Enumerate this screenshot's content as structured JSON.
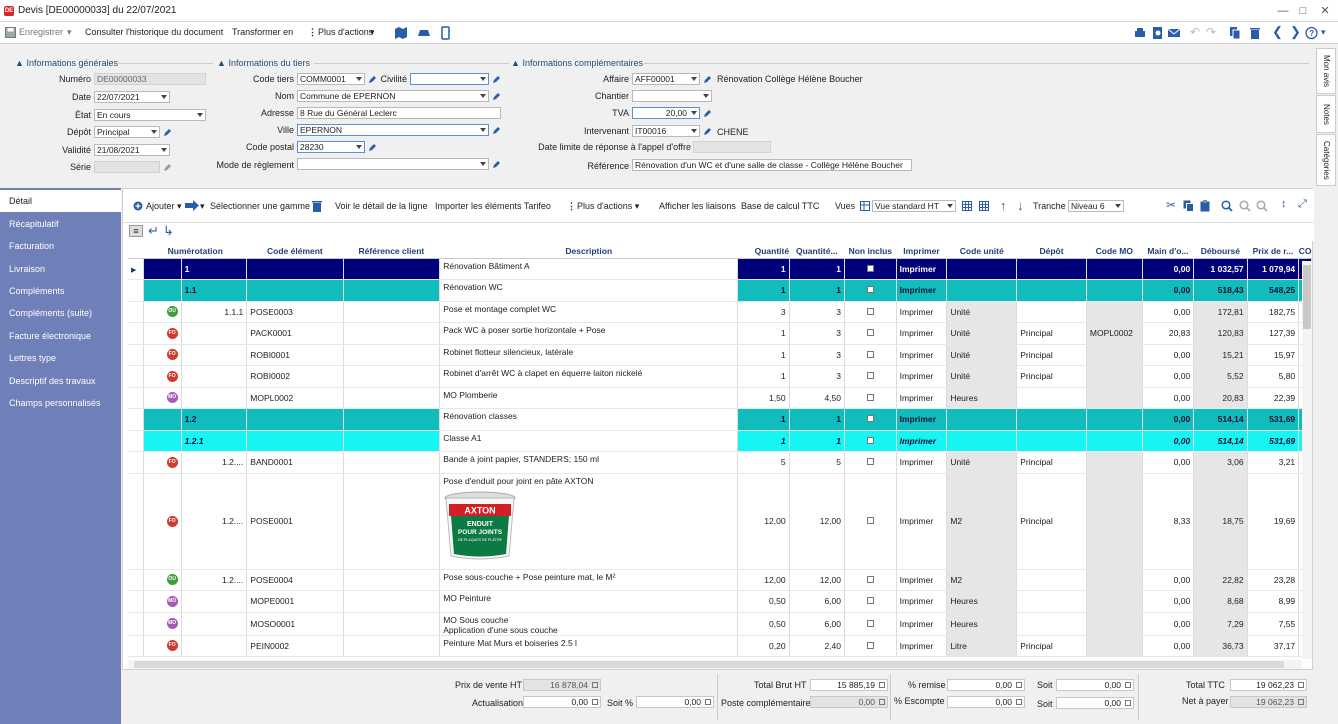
{
  "window": {
    "title": "Devis [DE00000033] du 22/07/2021",
    "app_icon": "DE"
  },
  "toolbar": {
    "save": "Enregistrer",
    "history": "Consulter l'historique du document",
    "transform": "Transformer en",
    "more_actions": "Plus d'actions"
  },
  "sections": {
    "general": "Informations générales",
    "tiers": "Informations du tiers",
    "complementary": "Informations complémentaires"
  },
  "general": {
    "numero_label": "Numéro",
    "numero": "DE00000033",
    "date_label": "Date",
    "date": "22/07/2021",
    "etat_label": "État",
    "etat": "En cours",
    "depot_label": "Dépôt",
    "depot": "Principal",
    "validite_label": "Validité",
    "validite": "21/08/2021",
    "serie_label": "Série",
    "serie": ""
  },
  "tiers": {
    "code_label": "Code tiers",
    "code": "COMM0001",
    "civilite_label": "Civilité",
    "civilite": "",
    "nom_label": "Nom",
    "nom": "Commune de EPERNON",
    "adresse_label": "Adresse",
    "adresse": "8 Rue du Général Leclerc",
    "ville_label": "Ville",
    "ville": "EPERNON",
    "cp_label": "Code postal",
    "cp": "28230",
    "reglement_label": "Mode de règlement",
    "reglement": ""
  },
  "complementary": {
    "affaire_label": "Affaire",
    "affaire": "AFF00001",
    "affaire_name": "Rénovation Collège Hélène Boucher",
    "chantier_label": "Chantier",
    "chantier": "",
    "tva_label": "TVA",
    "tva": "20,00",
    "intervenant_label": "Intervenant",
    "intervenant": "IT00016",
    "intervenant_name": "CHENE",
    "date_limite_label": "Date limite de réponse à l'appel d'offre",
    "date_limite": "",
    "reference_label": "Référence",
    "reference": "Rénovation d'un WC et d'une salle de classe - Collège Hélène Boucher"
  },
  "side_tabs": [
    "Mon avis",
    "Notes",
    "Catégories"
  ],
  "nav": [
    "Détail",
    "Récapitulatif",
    "Facturation",
    "Livraison",
    "Compléments",
    "Compléments (suite)",
    "Facture électronique",
    "Lettres type",
    "Descriptif des travaux",
    "Champs personnalisés"
  ],
  "grid_toolbar": {
    "add": "Ajouter",
    "select_range": "Sélectionner une gamme",
    "line_detail": "Voir le détail de la ligne",
    "import": "Importer les éléments Tarifeo",
    "more_actions": "Plus d'actions",
    "show_links": "Afficher les liaisons",
    "ttc_base": "Base de calcul TTC",
    "views_label": "Vues",
    "view": "Vue standard HT",
    "tranche_label": "Tranche",
    "tranche": "Niveau 6"
  },
  "columns": [
    "Numérotation",
    "Code élément",
    "Référence client",
    "Description",
    "Quantité",
    "Quantité...",
    "Non inclus",
    "Imprimer",
    "Code unité",
    "Dépôt",
    "Code MO",
    "Main d'o...",
    "Déboursé",
    "Prix de r...",
    "CO"
  ],
  "rows": [
    {
      "level": "lv1",
      "num": "1",
      "code": "",
      "desc": "Rénovation Bâtiment A",
      "qte": "1",
      "qte2": "1",
      "print": "Imprimer",
      "unit": "",
      "depot": "",
      "mo": "",
      "main": "0,00",
      "debourse": "1 032,57",
      "prix": "1 079,94"
    },
    {
      "level": "lv2",
      "num": "1.1",
      "code": "",
      "desc": "Rénovation WC",
      "qte": "1",
      "qte2": "1",
      "print": "Imprimer",
      "unit": "",
      "depot": "",
      "mo": "",
      "main": "0,00",
      "debourse": "518,43",
      "prix": "548,25"
    },
    {
      "level": "item",
      "badge": "OU",
      "num": "1.1.1",
      "code": "POSE0003",
      "desc": "Pose et montage complet WC",
      "qte": "3",
      "qte2": "3",
      "print": "Imprimer",
      "unit": "Unité",
      "depot": "",
      "mo": "",
      "main": "0,00",
      "debourse": "172,81",
      "prix": "182,75"
    },
    {
      "level": "item",
      "badge": "FO",
      "num": "",
      "code": "PACK0001",
      "desc": "Pack WC à poser sortie horizontale + Pose",
      "qte": "1",
      "qte2": "3",
      "print": "Imprimer",
      "unit": "Unité",
      "depot": "Principal",
      "mo": "MOPL0002",
      "main": "20,83",
      "debourse": "120,83",
      "prix": "127,39"
    },
    {
      "level": "item",
      "badge": "FO",
      "num": "",
      "code": "ROBI0001",
      "desc": "Robinet flotteur silencieux, latérale",
      "qte": "1",
      "qte2": "3",
      "print": "Imprimer",
      "unit": "Unité",
      "depot": "Principal",
      "mo": "",
      "main": "0,00",
      "debourse": "15,21",
      "prix": "15,97"
    },
    {
      "level": "item",
      "badge": "FO",
      "num": "",
      "code": "ROBI0002",
      "desc": "Robinet d'arrêt WC à clapet en équerre laiton nickelé",
      "qte": "1",
      "qte2": "3",
      "print": "Imprimer",
      "unit": "Unité",
      "depot": "Principal",
      "mo": "",
      "main": "0,00",
      "debourse": "5,52",
      "prix": "5,80"
    },
    {
      "level": "item",
      "badge": "MO",
      "num": "",
      "code": "MOPL0002",
      "desc": "MO Plomberie",
      "qte": "1,50",
      "qte2": "4,50",
      "print": "Imprimer",
      "unit": "Heures",
      "depot": "",
      "mo": "",
      "main": "0,00",
      "debourse": "20,83",
      "prix": "22,39"
    },
    {
      "level": "lv2",
      "num": "1.2",
      "code": "",
      "desc": "Rénovation classes",
      "qte": "1",
      "qte2": "1",
      "print": "Imprimer",
      "unit": "",
      "depot": "",
      "mo": "",
      "main": "0,00",
      "debourse": "514,14",
      "prix": "531,69"
    },
    {
      "level": "lv3",
      "num": "1.2.1",
      "code": "",
      "desc": "Classe A1",
      "qte": "1",
      "qte2": "1",
      "print": "Imprimer",
      "unit": "",
      "depot": "",
      "mo": "",
      "main": "0,00",
      "debourse": "514,14",
      "prix": "531,69"
    },
    {
      "level": "item",
      "badge": "FO",
      "num": "1.2....",
      "code": "BAND0001",
      "desc": "Bande à joint papier, STANDERS; 150 ml",
      "qte": "5",
      "qte2": "5",
      "print": "Imprimer",
      "unit": "Unité",
      "depot": "Principal",
      "mo": "",
      "main": "0,00",
      "debourse": "3,06",
      "prix": "3,21"
    },
    {
      "level": "item",
      "badge": "FO",
      "num": "1.2....",
      "code": "POSE0001",
      "desc": "Pose d'enduit pour joint en pâte AXTON",
      "qte": "12,00",
      "qte2": "12,00",
      "print": "Imprimer",
      "unit": "M2",
      "depot": "Principal",
      "mo": "",
      "main": "8,33",
      "debourse": "18,75",
      "prix": "19,69",
      "image": true
    },
    {
      "level": "item",
      "badge": "OU",
      "num": "1.2....",
      "code": "POSE0004",
      "desc": "Pose sous-couche + Pose peinture mat, le M²",
      "qte": "12,00",
      "qte2": "12,00",
      "print": "Imprimer",
      "unit": "M2",
      "depot": "",
      "mo": "",
      "main": "0,00",
      "debourse": "22,82",
      "prix": "23,28"
    },
    {
      "level": "item",
      "badge": "MO",
      "num": "",
      "code": "MOPE0001",
      "desc": "MO Peinture",
      "qte": "0,50",
      "qte2": "6,00",
      "print": "Imprimer",
      "unit": "Heures",
      "depot": "",
      "mo": "",
      "main": "0,00",
      "debourse": "8,68",
      "prix": "8,99"
    },
    {
      "level": "item",
      "badge": "MO",
      "num": "",
      "code": "MOSO0001",
      "desc": "MO Sous couche",
      "desc2": "Application d'une sous couche",
      "qte": "0,50",
      "qte2": "6,00",
      "print": "Imprimer",
      "unit": "Heures",
      "depot": "",
      "mo": "",
      "main": "0,00",
      "debourse": "7,29",
      "prix": "7,55"
    },
    {
      "level": "item",
      "badge": "FO",
      "num": "",
      "code": "PEIN0002",
      "desc": "Peinture Mat Murs et boiseries 2.5 l",
      "qte": "0,20",
      "qte2": "2,40",
      "print": "Imprimer",
      "unit": "Litre",
      "depot": "Principal",
      "mo": "",
      "main": "0,00",
      "debourse": "36,73",
      "prix": "37,17"
    }
  ],
  "product_image": {
    "brand": "AXTON",
    "line1": "ENDUIT",
    "line2": "POUR JOINTS",
    "line3": "DE PLAQUES DE PLÂTRE"
  },
  "footer": {
    "prix_vente_label": "Prix de vente HT",
    "prix_vente": "16 878,04",
    "actualisation_label": "Actualisation",
    "actualisation": "0,00",
    "soit_pct_label": "Soit %",
    "soit_pct": "0,00",
    "total_brut_label": "Total Brut HT",
    "total_brut": "15 885,19",
    "poste_label": "Poste complémentaire",
    "poste": "0,00",
    "remise_label": "% remise",
    "remise": "0,00",
    "escompte_label": "% Escompte",
    "escompte": "0,00",
    "soit1_label": "Soit",
    "soit1": "0,00",
    "soit2_label": "Soit",
    "soit2": "0,00",
    "ttc_label": "Total TTC",
    "ttc": "19 062,23",
    "net_label": "Net à payer",
    "net": "19 062,23"
  }
}
